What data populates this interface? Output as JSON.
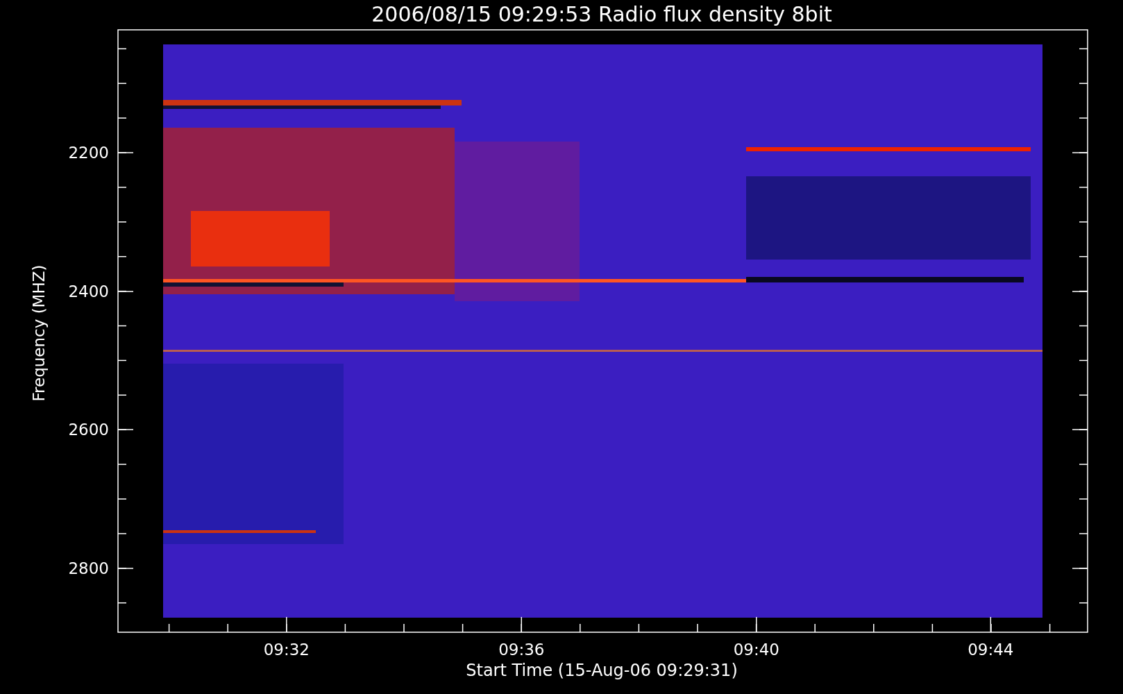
{
  "title": "2006/08/15 09:29:53 Radio flux density 8bit",
  "y_axis": {
    "label": "Frequency (MHZ)",
    "ticks": [
      "2200",
      "2400",
      "2600",
      "2800"
    ]
  },
  "x_axis": {
    "label": "Start Time (15-Aug-06 09:29:31)",
    "ticks": [
      "09:32",
      "09:36",
      "09:40",
      "09:44"
    ]
  }
}
